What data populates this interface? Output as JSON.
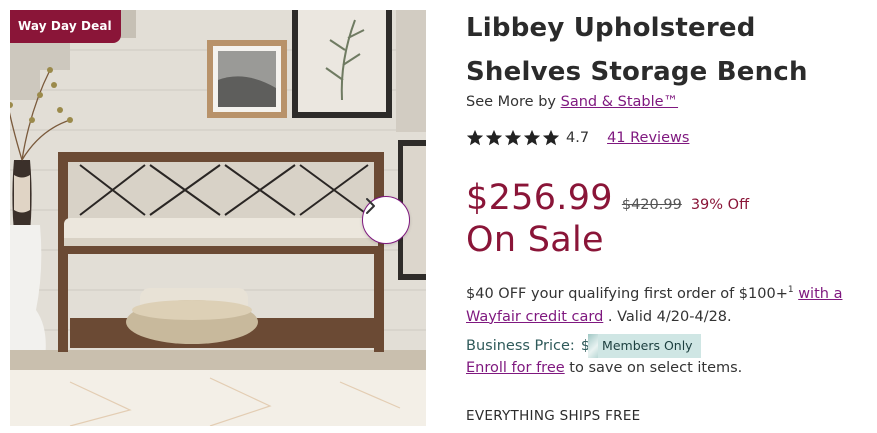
{
  "gallery": {
    "badge": "Way Day Deal",
    "next_icon": "chevron-right-icon"
  },
  "product": {
    "title": "Libbey Upholstered Shelves Storage Bench",
    "see_more_prefix": "See More by",
    "brand": "Sand & Stable™",
    "rating": "4.7",
    "rating_out_of": 5,
    "reviews": "41 Reviews"
  },
  "pricing": {
    "price": "$256.99",
    "was_price": "$420.99",
    "percent_off": "39% Off",
    "sale_label": "On Sale"
  },
  "promo": {
    "text_before": "$40 OFF your qualifying first order of $100+",
    "footnote": "1",
    "link": "with a Wayfair credit card",
    "text_after": ". Valid 4/20-4/28."
  },
  "business": {
    "label": "Business Price:",
    "currency": "$",
    "members_tag": "Members Only",
    "enroll_link": "Enroll for free",
    "enroll_text": "to save on select items."
  },
  "shipping": {
    "text": "EVERYTHING SHIPS FREE"
  },
  "colors": {
    "brand_purple": "#7f187f",
    "sale_red": "#8a1538",
    "business_teal": "#2f5a5a",
    "members_bg": "#cfe6e4"
  }
}
